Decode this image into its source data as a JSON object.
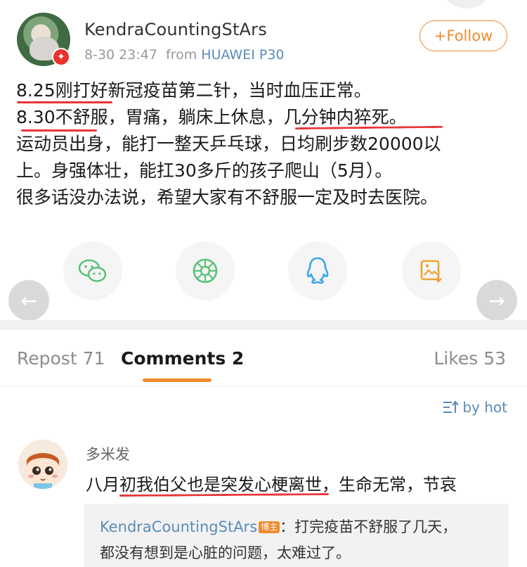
{
  "post": {
    "author": "KendraCountingStArs",
    "time": "8-30 23:47",
    "from_label": "from",
    "device": "HUAWEI P30",
    "follow_label": "+Follow",
    "lines": [
      "8.25刚打好新冠疫苗第二针，当时血压正常。",
      "8.30不舒服，胃痛，躺床上休息，几分钟内猝死。",
      "运动员出身，能打一整天乒乓球，日均刷步数20000以",
      "上。身强体壮，能扛30多斤的孩子爬山（5月）。",
      "很多话没办法说，希望大家有不舒服一定及时去医院。"
    ]
  },
  "share_icons": [
    "wechat-icon",
    "moments-icon",
    "qq-icon",
    "save-image-icon"
  ],
  "tabs": {
    "repost": "Repost 71",
    "comments": "Comments 2",
    "likes": "Likes 53"
  },
  "sort_label": "by hot",
  "comment": {
    "name": "多米发",
    "text": "八月初我伯父也是突发心梗离世，生命无常，节哀",
    "reply": {
      "name": "KendraCountingStArs",
      "badge": "博主",
      "line1": "：打完疫苗不舒服了几天，",
      "line2": "都没有想到是心脏的问题，太难过了。"
    }
  },
  "colors": {
    "accent": "#f08a2c",
    "link": "#5b8bb9",
    "annotation": "#e8363a"
  }
}
